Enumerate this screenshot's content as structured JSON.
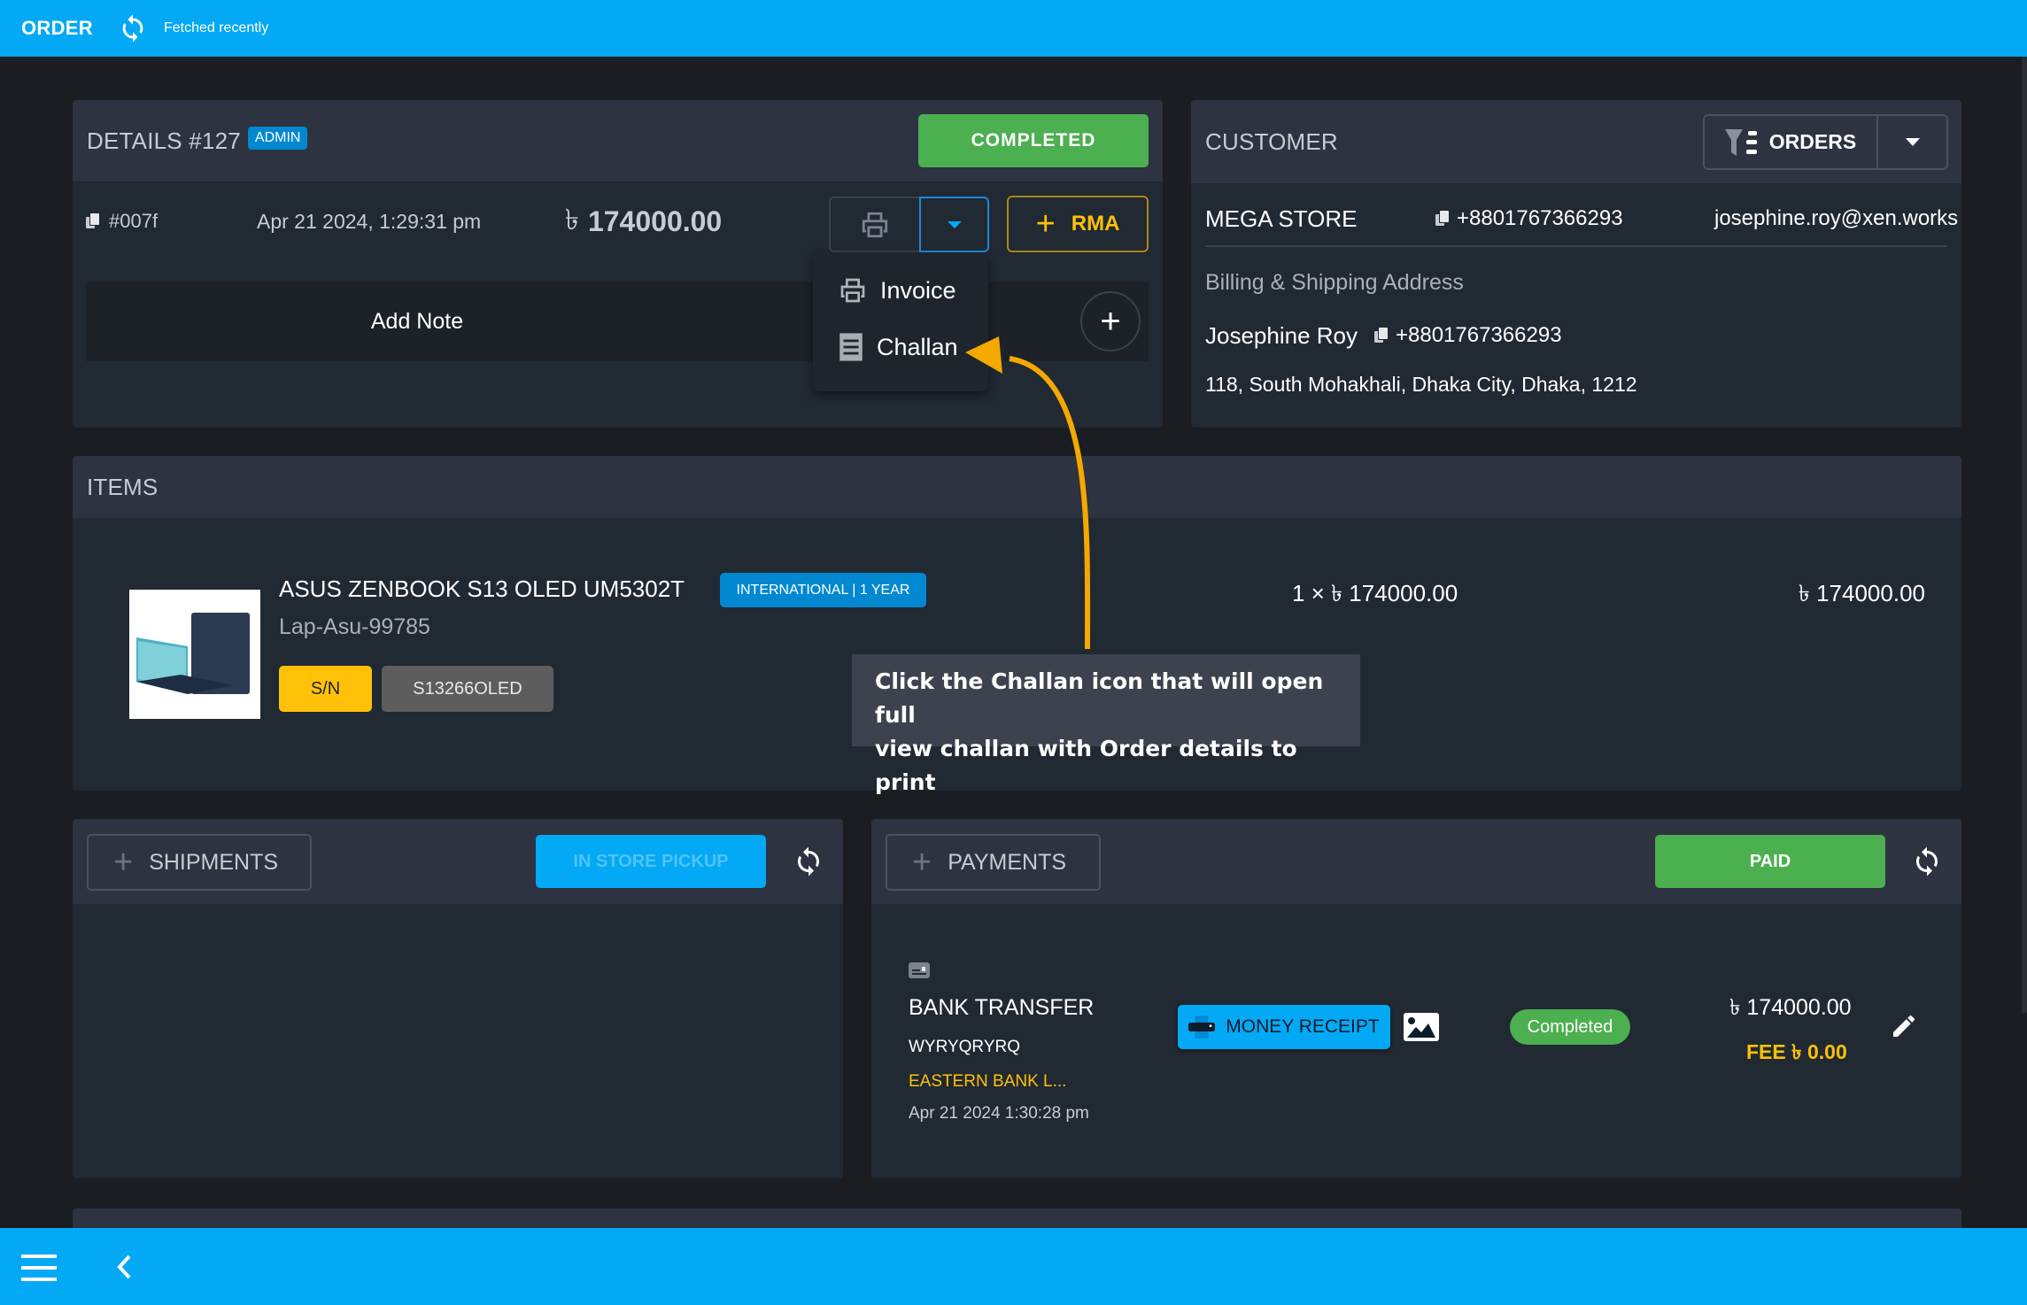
{
  "topbar": {
    "title": "ORDER",
    "sync_icon": "sync-icon",
    "status": "Fetched recently"
  },
  "details": {
    "title": "DETAILS #127",
    "role_badge": "ADMIN",
    "status_button": "COMPLETED",
    "order_ref": "#007f",
    "date": "Apr 21 2024, 1:29:31 pm",
    "currency_symbol": "৳",
    "total": "174000.00",
    "rma_label": "RMA",
    "add_note_label": "Add Note",
    "print_menu": [
      {
        "label": "Invoice",
        "icon": "printer-icon"
      },
      {
        "label": "Challan",
        "icon": "receipt-icon"
      }
    ]
  },
  "customer": {
    "title": "CUSTOMER",
    "orders_button": "ORDERS",
    "name": "MEGA STORE",
    "phone": "+8801767366293",
    "email": "josephine.roy@xen.works",
    "address_heading": "Billing & Shipping Address",
    "contact_name": "Josephine Roy",
    "contact_phone": "+8801767366293",
    "address": "118, South Mohakhali, Dhaka City, Dhaka, 1212"
  },
  "items": {
    "title": "ITEMS",
    "list": [
      {
        "name": "ASUS ZENBOOK S13 OLED UM5302T",
        "sku": "Lap-Asu-99785",
        "warranty": "INTERNATIONAL | 1 YEAR",
        "sn_label": "S/N",
        "serial": "S13266OLED",
        "quantity_line": "1 × ৳ 174000.00",
        "line_total": "৳ 174000.00"
      }
    ]
  },
  "annotation": {
    "text_line1": "Click the Challan icon that will open full",
    "text_line2": "view challan with Order details to print"
  },
  "shipments": {
    "title": "SHIPMENTS",
    "method_button": "IN STORE PICKUP"
  },
  "payments": {
    "title": "PAYMENTS",
    "status_button": "PAID",
    "entries": [
      {
        "method": "BANK TRANSFER",
        "reference": "WYRYQRYRQ",
        "bank": "EASTERN BANK L...",
        "date": "Apr 21 2024 1:30:28 pm",
        "receipt_button": "MONEY RECEIPT",
        "status": "Completed",
        "amount": "৳ 174000.00",
        "fee": "FEE ৳ 0.00"
      }
    ]
  },
  "colors": {
    "primary": "#03a9f4",
    "success": "#4caf50",
    "warning": "#ffc107",
    "annotation_arrow": "#f5a800"
  }
}
